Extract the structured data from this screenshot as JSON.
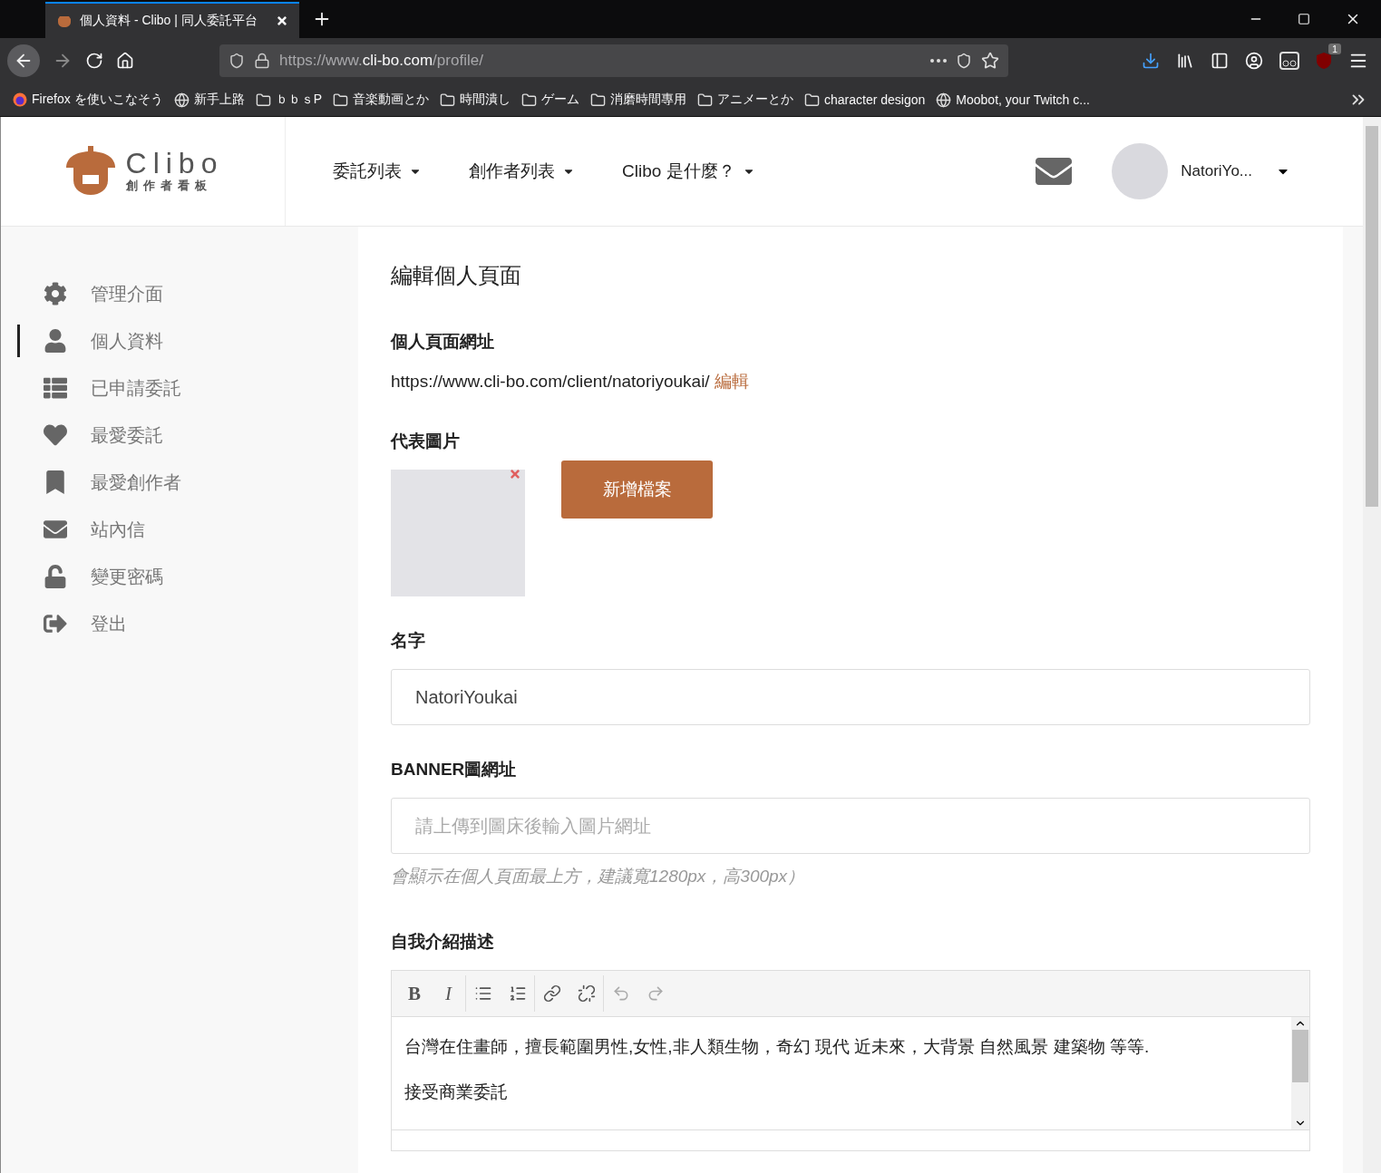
{
  "browser": {
    "tab": {
      "title": "個人資料 - Clibo | 同人委託平台",
      "selected": true
    },
    "url": [
      {
        "text": "https://www.",
        "strong": false
      },
      {
        "text": "cli-bo.com",
        "strong": true
      },
      {
        "text": "/profile/",
        "strong": false
      }
    ],
    "addon_badge": "1",
    "bookmarks": [
      {
        "label": "Firefox を使いこなそう",
        "kind": "firefox"
      },
      {
        "label": "新手上路",
        "kind": "globe"
      },
      {
        "label": "ｂｂｓP",
        "kind": "folder"
      },
      {
        "label": "音楽動画とか",
        "kind": "folder"
      },
      {
        "label": "時間潰し",
        "kind": "folder"
      },
      {
        "label": "ゲーム",
        "kind": "folder"
      },
      {
        "label": "消磨時間專用",
        "kind": "folder"
      },
      {
        "label": "アニメーとか",
        "kind": "folder"
      },
      {
        "label": "character desigon",
        "kind": "folder"
      },
      {
        "label": "Moobot, your Twitch c...",
        "kind": "globe"
      }
    ]
  },
  "site_header": {
    "logo": {
      "name": "Clibo",
      "tagline": "創作者看板"
    },
    "nav": [
      {
        "label": "委託列表"
      },
      {
        "label": "創作者列表"
      },
      {
        "label": "Clibo 是什麼？"
      }
    ],
    "user": {
      "name": "NatoriYo..."
    }
  },
  "sidebar": {
    "items": [
      {
        "label": "管理介面",
        "selected": false
      },
      {
        "label": "個人資料",
        "selected": true
      },
      {
        "label": "已申請委託",
        "selected": false
      },
      {
        "label": "最愛委託",
        "selected": false
      },
      {
        "label": "最愛創作者",
        "selected": false
      },
      {
        "label": "站內信",
        "selected": false
      },
      {
        "label": "變更密碼",
        "selected": false
      },
      {
        "label": "登出",
        "selected": false
      }
    ]
  },
  "main": {
    "title": "編輯個人頁面",
    "profile_url": {
      "label": "個人頁面網址",
      "url": "https://www.cli-bo.com/client/natoriyoukai/",
      "edit_link": "編輯"
    },
    "picture": {
      "label": "代表圖片",
      "button": "新增檔案"
    },
    "name": {
      "label": "名字",
      "value": "NatoriYoukai"
    },
    "banner": {
      "label": "BANNER圖網址",
      "placeholder": "請上傳到圖床後輸入圖片網址",
      "help": "會顯示在個人頁面最上方，建議寬1280px，高300px）"
    },
    "bio": {
      "label": "自我介紹描述",
      "toolbar": [
        {
          "kind": "bold",
          "text": "B"
        },
        {
          "kind": "italic",
          "text": "I"
        },
        {
          "kind": "bullets"
        },
        {
          "kind": "numbers"
        },
        {
          "kind": "link"
        },
        {
          "kind": "unlink"
        },
        {
          "kind": "undo"
        },
        {
          "kind": "redo"
        }
      ],
      "paragraphs": [
        "台灣在住畫師，擅長範圍男性,女性,非人類生物，奇幻 現代 近未來，大背景 自然風景 建築物 等等.",
        "接受商業委託"
      ]
    }
  }
}
